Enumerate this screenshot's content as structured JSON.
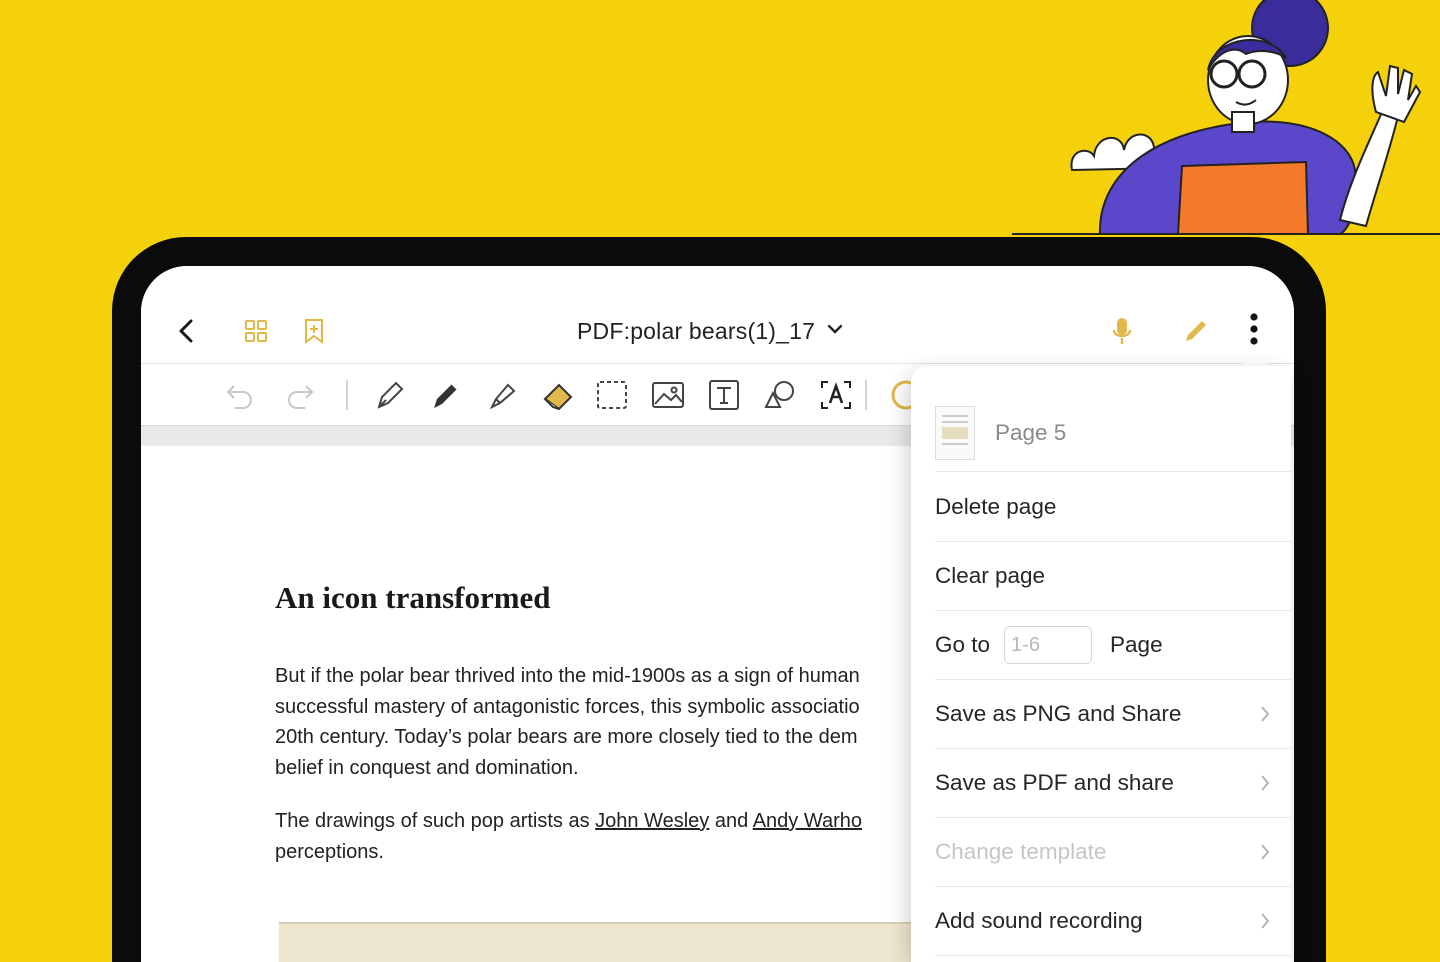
{
  "header": {
    "title": "PDF:polar bears(1)_17"
  },
  "document": {
    "heading": "An icon transformed",
    "para1": [
      "But if the polar bear thrived into the mid-1900s as a sign of human",
      "successful mastery of antagonistic forces, this symbolic associatio",
      "20th century. Today’s polar bears are more closely tied to the dem",
      "belief in conquest and domination."
    ],
    "para2_line1_start": "The drawings of such pop artists as ",
    "para2_link1": "John Wesley",
    "para2_mid": " and ",
    "para2_link2": "Andy Warho",
    "para2_line2": "perceptions."
  },
  "menu": {
    "page_label": "Page 5",
    "delete": "Delete page",
    "clear": "Clear page",
    "goto_label": "Go to",
    "goto_placeholder": "1-6",
    "goto_suffix": "Page",
    "save_png": "Save as PNG and Share",
    "save_pdf": "Save as PDF and share",
    "change_template": "Change template",
    "add_sound": "Add sound recording"
  },
  "colors": {
    "background": "#F5D10C",
    "accent": "#E3B84B",
    "illustration_purple": "#5B47C9",
    "illustration_orange": "#F47A2A"
  }
}
